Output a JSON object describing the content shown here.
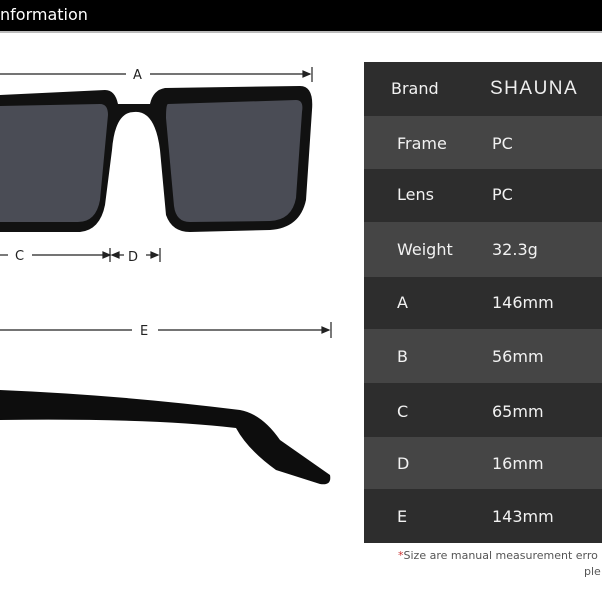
{
  "header": {
    "title": "nformation"
  },
  "dimension_labels": {
    "a": "A",
    "c": "C",
    "d": "D",
    "e": "E"
  },
  "table": [
    {
      "key": "Brand",
      "value": "SHAUNA"
    },
    {
      "key": "Frame",
      "value": "PC"
    },
    {
      "key": "Lens",
      "value": "PC"
    },
    {
      "key": "Weight",
      "value": "32.3g"
    },
    {
      "key": "A",
      "value": "146mm"
    },
    {
      "key": "B",
      "value": "56mm"
    },
    {
      "key": "C",
      "value": "65mm"
    },
    {
      "key": "D",
      "value": "16mm"
    },
    {
      "key": "E",
      "value": "143mm"
    }
  ],
  "note": {
    "asterisk": "*",
    "line1": "Size are manual measurement erro",
    "line2": "ple"
  },
  "colors": {
    "row_dark": "#2d2d2d",
    "row_light": "#454545",
    "header": "#000000"
  }
}
